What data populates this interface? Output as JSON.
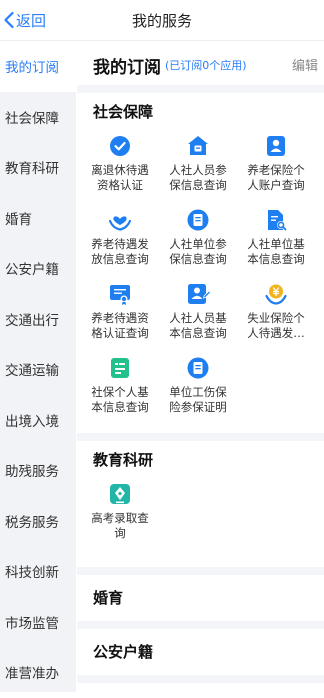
{
  "header": {
    "back_label": "返回",
    "title": "我的服务"
  },
  "sidebar": {
    "items": [
      {
        "label": "我的订阅"
      },
      {
        "label": "社会保障"
      },
      {
        "label": "教育科研"
      },
      {
        "label": "婚育"
      },
      {
        "label": "公安户籍"
      },
      {
        "label": "交通出行"
      },
      {
        "label": "交通运输"
      },
      {
        "label": "出境入境"
      },
      {
        "label": "助残服务"
      },
      {
        "label": "税务服务"
      },
      {
        "label": "科技创新"
      },
      {
        "label": "市场监管"
      },
      {
        "label": "准营准办"
      }
    ]
  },
  "main": {
    "subscription": {
      "title": "我的订阅",
      "count_text": "(已订阅0个应用)",
      "edit_label": "编辑"
    },
    "sections": [
      {
        "title": "社会保障",
        "items": [
          {
            "line1": "离退休待遇",
            "line2": "资格认证",
            "icon": "shield-check-icon"
          },
          {
            "line1": "人社人员参",
            "line2": "保信息查询",
            "icon": "house-bao-icon"
          },
          {
            "line1": "养老保险个",
            "line2": "人账户查询",
            "icon": "person-card-icon"
          },
          {
            "line1": "养老待遇发",
            "line2": "放信息查询",
            "icon": "heart-hands-icon"
          },
          {
            "line1": "人社单位参",
            "line2": "保信息查询",
            "icon": "document-icon"
          },
          {
            "line1": "人社单位基",
            "line2": "本信息查询",
            "icon": "file-search-icon"
          },
          {
            "line1": "养老待遇资",
            "line2": "格认证查询",
            "icon": "certificate-icon"
          },
          {
            "line1": "人社人员基",
            "line2": "本信息查询",
            "icon": "person-edit-icon"
          },
          {
            "line1": "失业保险个",
            "line2": "人待遇发…",
            "icon": "yuan-hand-icon"
          },
          {
            "line1": "社保个人基",
            "line2": "本信息查询",
            "icon": "id-card-icon"
          },
          {
            "line1": "单位工伤保",
            "line2": "险参保证明",
            "icon": "document-icon"
          }
        ]
      },
      {
        "title": "教育科研",
        "items": [
          {
            "line1": "高考录取查",
            "line2": "询",
            "icon": "pen-nib-icon"
          }
        ]
      },
      {
        "title": "婚育",
        "items": []
      },
      {
        "title": "公安户籍",
        "items": []
      }
    ]
  },
  "colors": {
    "accent": "#2a7dfb",
    "icon_blue": "#1f7ff0",
    "icon_yellow": "#f2b31d",
    "sidebar_bg": "#f2f3f7"
  }
}
